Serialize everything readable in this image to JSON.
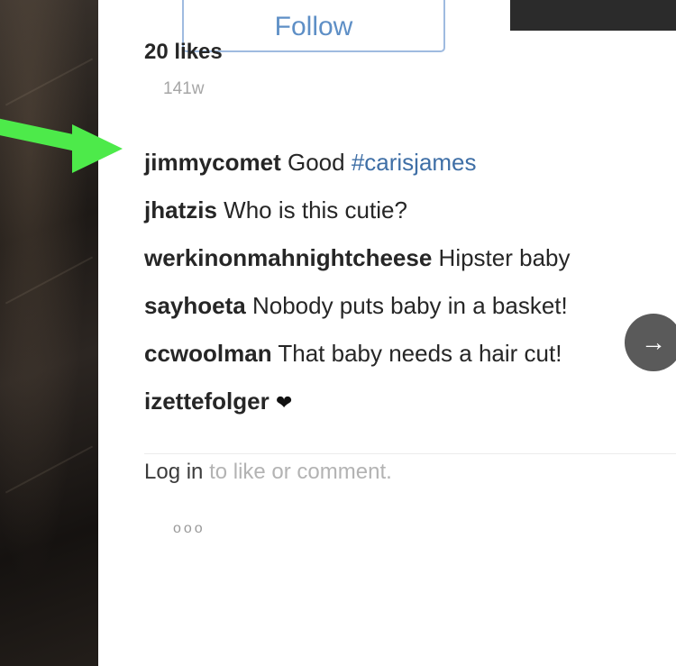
{
  "header": {
    "follow_label": "Follow"
  },
  "post": {
    "likes": "20 likes",
    "age": "141w"
  },
  "comments": [
    {
      "user": "jimmycomet",
      "text": "Good",
      "hashtag": "#carisjames"
    },
    {
      "user": "jhatzis",
      "text": "Who is this cutie?"
    },
    {
      "user": "werkinonmahnightcheese",
      "text": "Hipster baby"
    },
    {
      "user": "sayhoeta",
      "text": "Nobody puts baby in a basket!"
    },
    {
      "user": "ccwoolman",
      "text": "That baby needs a hair cut!"
    },
    {
      "user": "izettefolger",
      "text": "❤"
    }
  ],
  "footer": {
    "login_link": "Log in",
    "login_suffix": "to like or comment.",
    "more_label": "ooo"
  },
  "nav": {
    "next_icon": "→"
  },
  "colors": {
    "arrow_annotation": "#4dea4a",
    "hashtag": "#3f6fa6",
    "follow_border": "#9fbbe0"
  }
}
